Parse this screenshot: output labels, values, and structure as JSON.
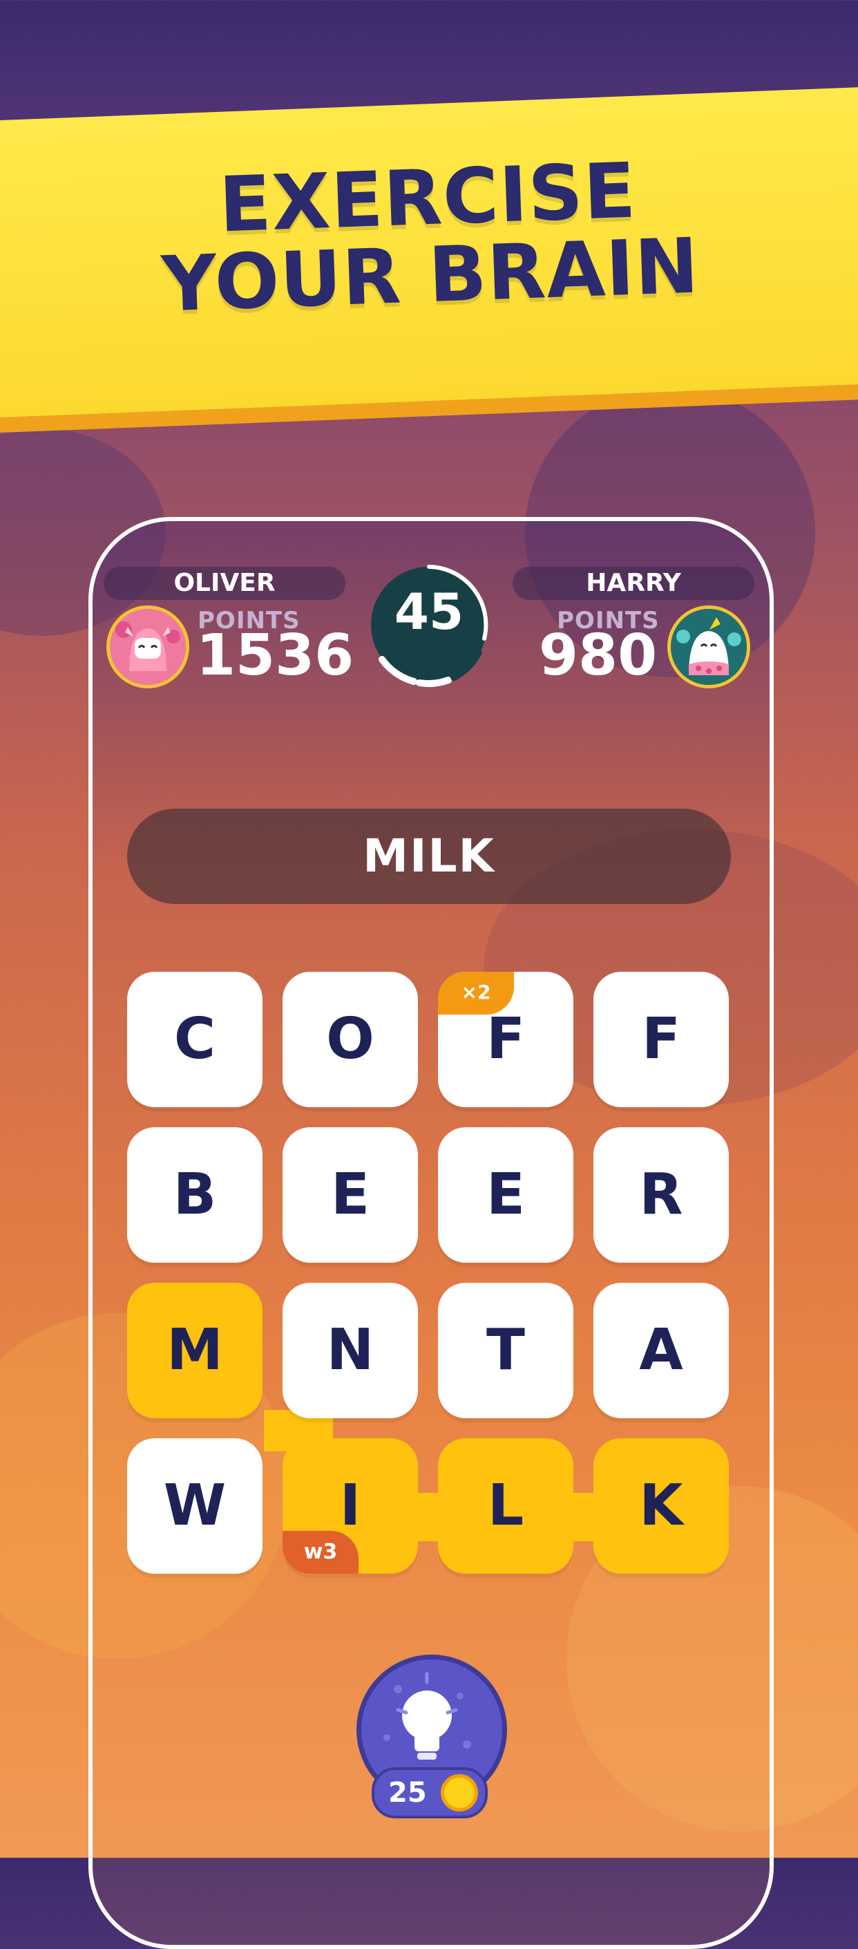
{
  "banner": {
    "line1": "EXERCISE",
    "line2": "YOUR BRAIN"
  },
  "players": [
    {
      "name": "OLIVER",
      "points_label": "POINTS",
      "points": "1536"
    },
    {
      "name": "HARRY",
      "points_label": "POINTS",
      "points": "980"
    }
  ],
  "timer": {
    "seconds": "45"
  },
  "current_word": "MILK",
  "grid": {
    "rows": [
      [
        "C",
        "O",
        "F",
        "F"
      ],
      [
        "B",
        "E",
        "E",
        "R"
      ],
      [
        "M",
        "N",
        "T",
        "A"
      ],
      [
        "W",
        "I",
        "L",
        "K"
      ]
    ],
    "multiplier_badge": "×2",
    "word_badge": "w3"
  },
  "hint": {
    "cost": "25",
    "icon": "lightbulb-icon"
  },
  "colors": {
    "banner": "#fcd92f",
    "text_dark": "#1f2257",
    "selected_tile": "#ffc20e",
    "hint_button": "#5b56c7"
  }
}
